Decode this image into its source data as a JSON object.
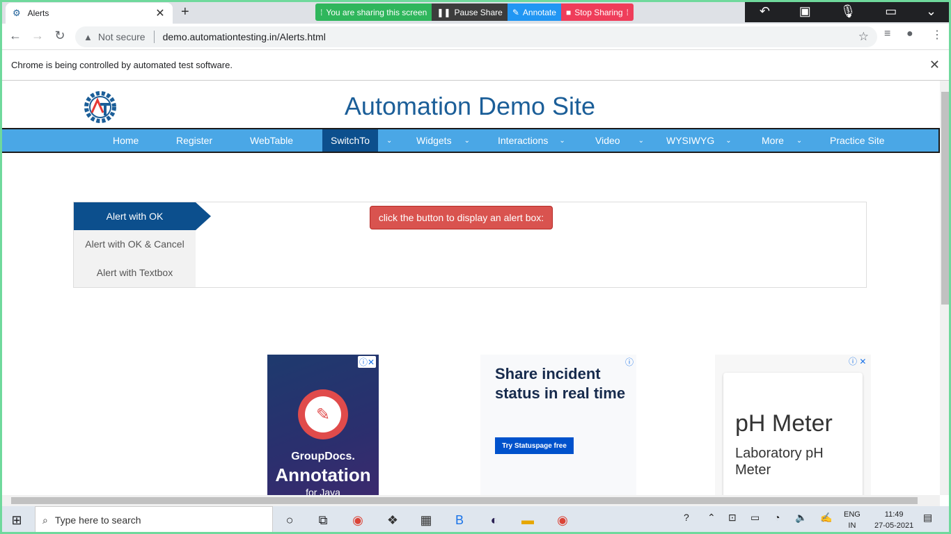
{
  "browser": {
    "tab_title": "Alerts",
    "url": "demo.automationtesting.in/Alerts.html",
    "security_label": "Not secure",
    "info_message": "Chrome is being controlled by automated test software."
  },
  "share_bar": {
    "status": "You are sharing this screen",
    "pause": "Pause Share",
    "annotate": "Annotate",
    "stop": "Stop Sharing"
  },
  "site": {
    "title": "Automation Demo Site",
    "menu": [
      {
        "label": "Home"
      },
      {
        "label": "Register"
      },
      {
        "label": "WebTable"
      },
      {
        "label": "SwitchTo"
      },
      {
        "label": "Widgets"
      },
      {
        "label": "Interactions"
      },
      {
        "label": "Video"
      },
      {
        "label": "WYSIWYG"
      },
      {
        "label": "More"
      },
      {
        "label": "Practice Site"
      }
    ],
    "alert_tabs": [
      "Alert with OK",
      "Alert with OK & Cancel",
      "Alert with Textbox"
    ],
    "alert_button": "click the button to display an alert box:"
  },
  "ads": {
    "ad1": {
      "brand": "GroupDocs.",
      "product": "Annotation",
      "tail": "for Java"
    },
    "ad2": {
      "headline": "Share incident status in real time",
      "cta": "Try Statuspage free"
    },
    "ad3": {
      "title": "pH Meter",
      "subtitle": "Laboratory pH Meter"
    }
  },
  "taskbar": {
    "search_placeholder": "Type here to search",
    "lang1": "ENG",
    "lang2": "IN",
    "time": "11:49",
    "date": "27-05-2021"
  },
  "colors": {
    "nav": "#4aa7e6",
    "nav_active": "#0c4f8d",
    "title": "#1b5e98",
    "alert_button": "#d9534f"
  }
}
